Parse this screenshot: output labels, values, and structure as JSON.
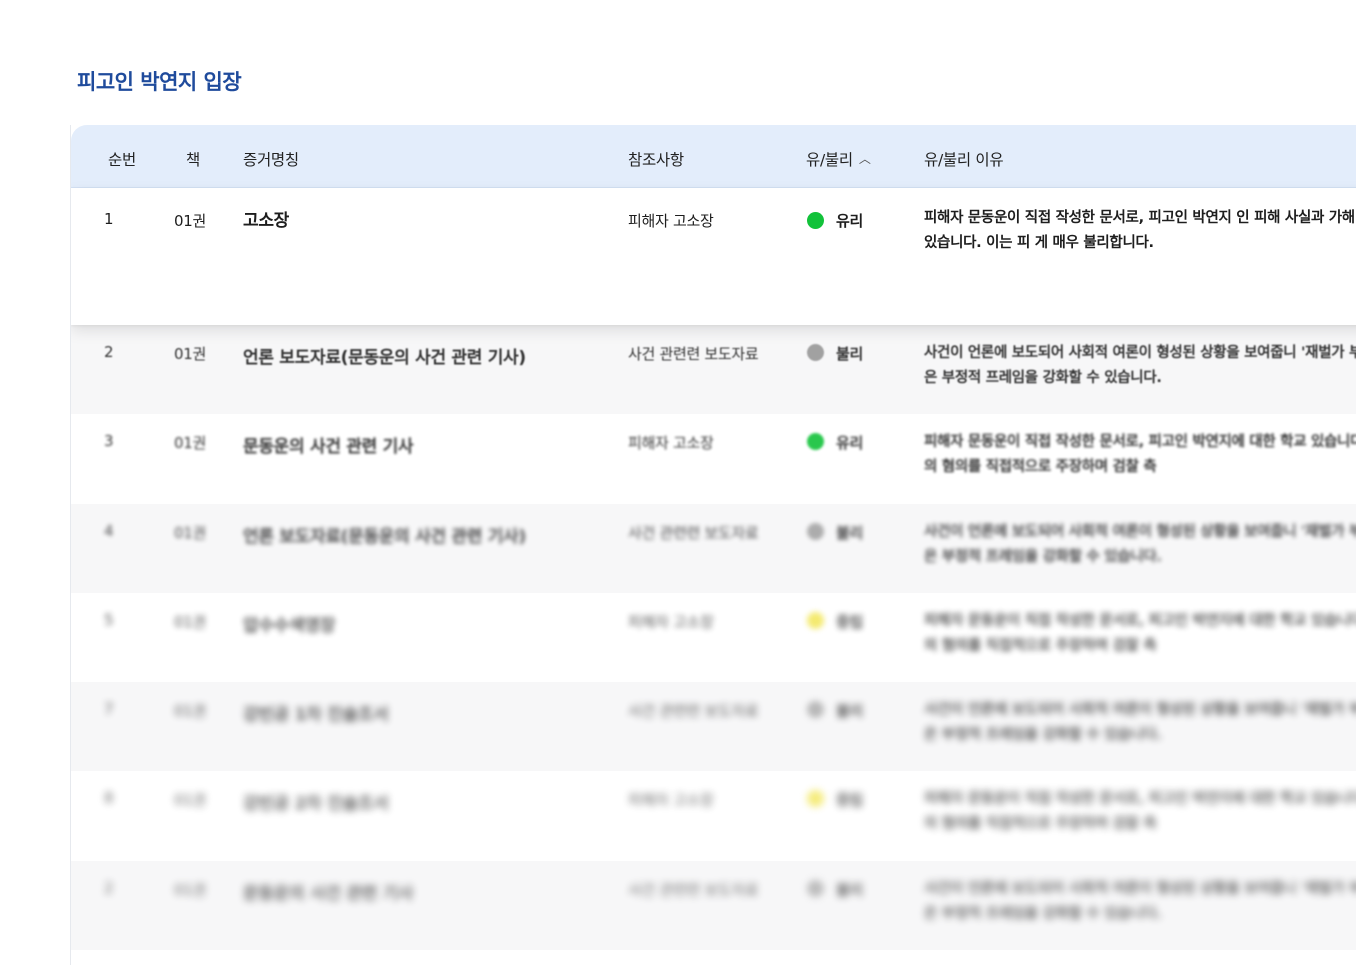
{
  "page_title": "피고인 박연지 입장",
  "columns": {
    "no": "순번",
    "volume": "책",
    "evidence": "증거명칭",
    "reference": "참조사항",
    "status": "유/불리",
    "reason": "유/불리 이유"
  },
  "status_colors": {
    "유리": "#12c23a",
    "불리": "#9a9a9a",
    "중립": "#f0e23a"
  },
  "rows": [
    {
      "no": "1",
      "volume": "01권",
      "name": "고소장",
      "reference": "피해자 고소장",
      "status": "유리",
      "status_color": "#12c23a",
      "reason": "피해자 문동운이 직접 작성한 문서로, 피고인 박연지 인 피해 사실과 가해 정황을 담고 있습니다. 이는 피 게 매우 불리합니다."
    },
    {
      "no": "2",
      "volume": "01권",
      "name": "언론 보도자료(문동운의 사건 관련 기사)",
      "reference": "사건 관련련 보도자료",
      "status": "불리",
      "status_color": "#9a9a9a",
      "reason": "사건이 언론에 보도되어 사회적 여론이 형성된 상황을 보여줍니 '재벌가 부인' 등의 표현은 부정적 프레임을 강화할 수 있습니다."
    },
    {
      "no": "3",
      "volume": "01권",
      "name": "문동운의 사건 관련 기사",
      "reference": "피해자 고소장",
      "status": "유리",
      "status_color": "#12c23a",
      "reason": "피해자 문동운이 직접 작성한 문서로, 피고인 박연지에 대한 학교 있습니다. 이는 피고인의 혐의를 직접적으로 주장하며 검찰 측"
    },
    {
      "no": "4",
      "volume": "01권",
      "name": "언론 보도자료(문동운의 사건 관련 기사)",
      "reference": "사건 관련련 보도자료",
      "status": "불리",
      "status_color": "#9a9a9a",
      "reason": "사건이 언론에 보도되어 사회적 여론이 형성된 상황을 보여줍니 '재벌가 부인' 등의 표현은 부정적 프레임을 강화할 수 있습니다."
    },
    {
      "no": "5",
      "volume": "01권",
      "name": "압수수색영장",
      "reference": "피해자 고소장",
      "status": "중립",
      "status_color": "#f0e23a",
      "reason": "피해자 문동운이 직접 작성한 문서로, 피고인 박연지에 대한 학교 있습니다. 이는 피고인의 혐의를 직접적으로 주장하며 검찰 측"
    },
    {
      "no": "7",
      "volume": "01권",
      "name": "강빈공 1차 진술조서",
      "reference": "사건 관련련 보도자료",
      "status": "불리",
      "status_color": "#9a9a9a",
      "reason": "사건이 언론에 보도되어 사회적 여론이 형성된 상황을 보여줍니 '재벌가 부인' 등의 표현은 부정적 프레임을 강화할 수 있습니다."
    },
    {
      "no": "8",
      "volume": "01권",
      "name": "강빈공 2차 진술조서",
      "reference": "피해자 고소장",
      "status": "중립",
      "status_color": "#f0e23a",
      "reason": "피해자 문동운이 직접 작성한 문서로, 피고인 박연지에 대한 학교 있습니다. 이는 피고인의 혐의를 직접적으로 주장하며 검찰 측"
    },
    {
      "no": "2",
      "volume": "01권",
      "name": "문동운의 사건 관련 기사",
      "reference": "사건 관련련 보도자료",
      "status": "불리",
      "status_color": "#9a9a9a",
      "reason": "사건이 언론에 보도되어 사회적 여론이 형성된 상황을 보여줍니 '재벌가 부인' 등의 표현은 부정적 프레임을 강화할 수 있습니다."
    }
  ]
}
